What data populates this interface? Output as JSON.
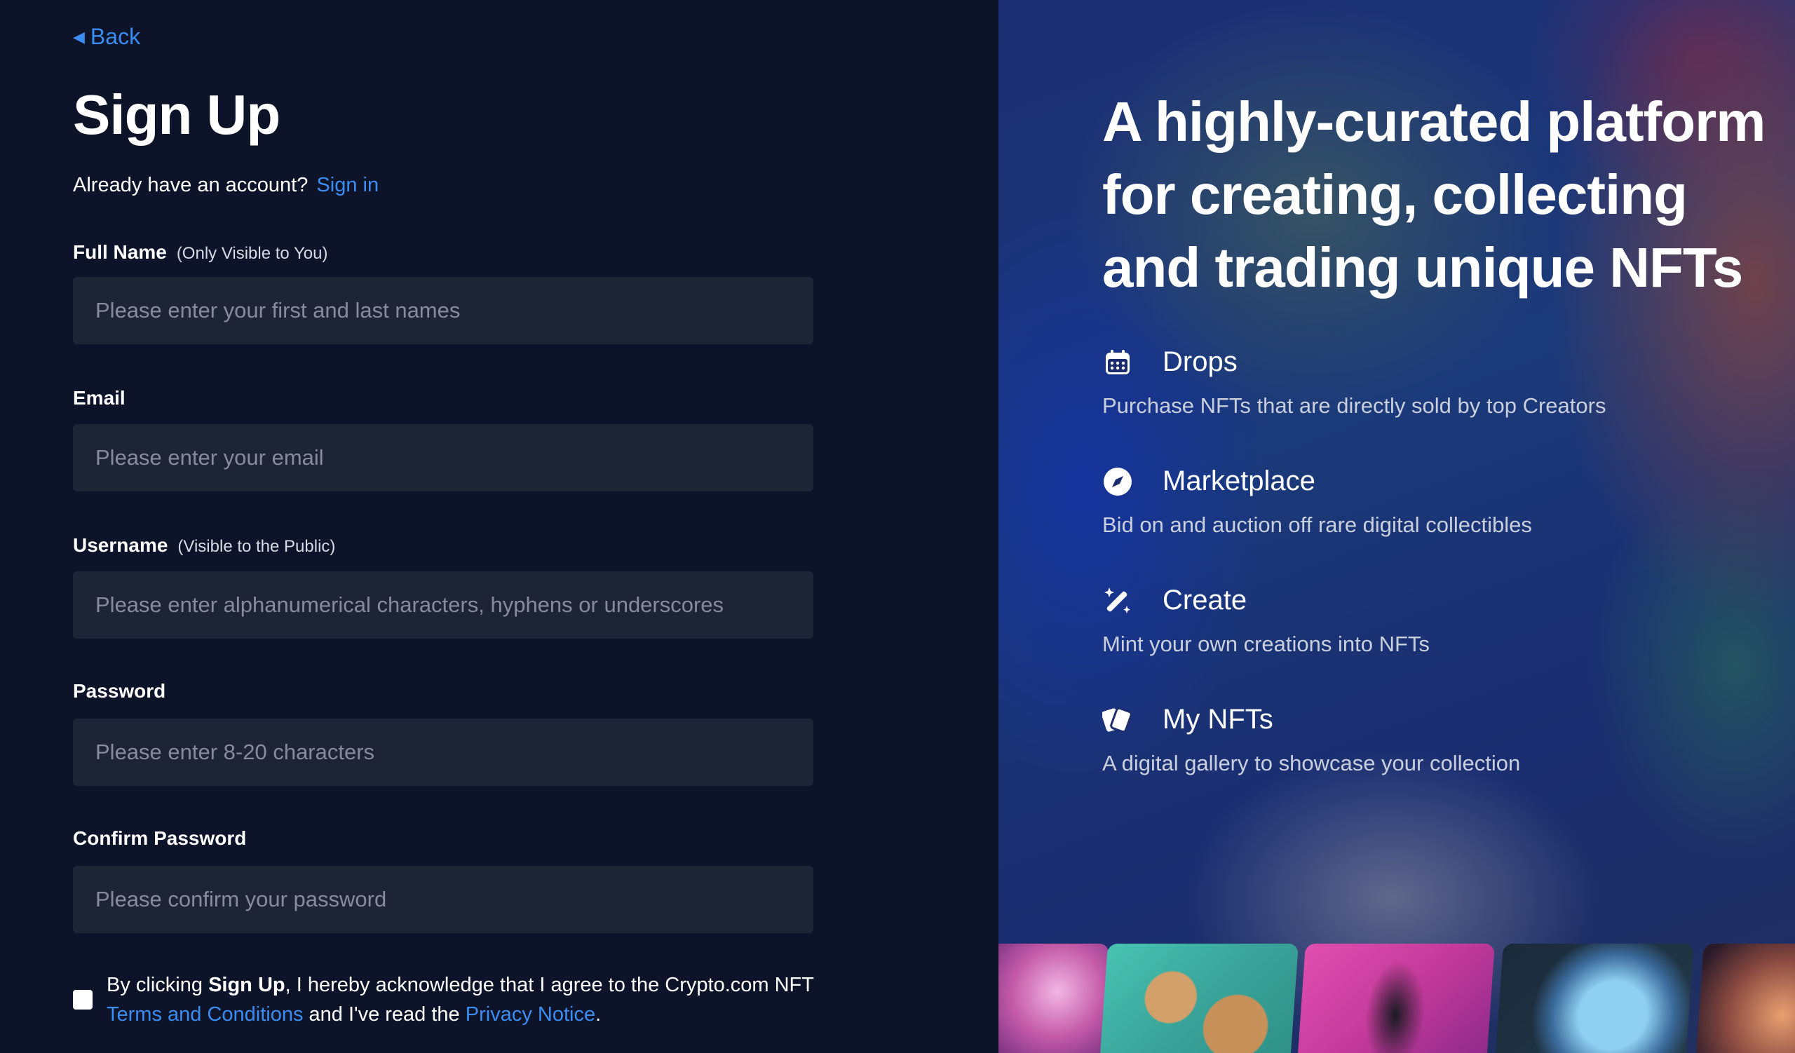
{
  "nav": {
    "back_label": "Back"
  },
  "form": {
    "title": "Sign Up",
    "already_text": "Already have an account?",
    "signin_label": "Sign in",
    "fields": [
      {
        "label": "Full Name",
        "hint": "(Only Visible to You)",
        "placeholder": "Please enter your first and last names"
      },
      {
        "label": "Email",
        "hint": "",
        "placeholder": "Please enter your email"
      },
      {
        "label": "Username",
        "hint": "(Visible to the Public)",
        "placeholder": "Please enter alphanumerical characters, hyphens or underscores"
      },
      {
        "label": "Password",
        "hint": "",
        "placeholder": "Please enter 8-20 characters"
      },
      {
        "label": "Confirm Password",
        "hint": "",
        "placeholder": "Please confirm your password"
      }
    ],
    "agree": {
      "prefix": "By clicking",
      "bold": "Sign Up",
      "middle": ", I hereby acknowledge that I agree to the Crypto.com NFT",
      "terms_label": "Terms and Conditions",
      "and_read": "and I've read the",
      "privacy_label": "Privacy Notice",
      "suffix": "."
    }
  },
  "promo": {
    "headline": "A highly-curated platform for creating, collecting and trading unique NFTs",
    "features": [
      {
        "icon": "calendar-icon",
        "title": "Drops",
        "desc": "Purchase NFTs that are directly sold by top Creators"
      },
      {
        "icon": "compass-icon",
        "title": "Marketplace",
        "desc": "Bid on and auction off rare digital collectibles"
      },
      {
        "icon": "magic-wand-icon",
        "title": "Create",
        "desc": "Mint your own creations into NFTs"
      },
      {
        "icon": "cards-icon",
        "title": "My NFTs",
        "desc": "A digital gallery to showcase your collection"
      }
    ]
  },
  "colors": {
    "accent": "#3a8df2",
    "panel_bg": "#0d1328",
    "input_bg": "#1d2436"
  }
}
